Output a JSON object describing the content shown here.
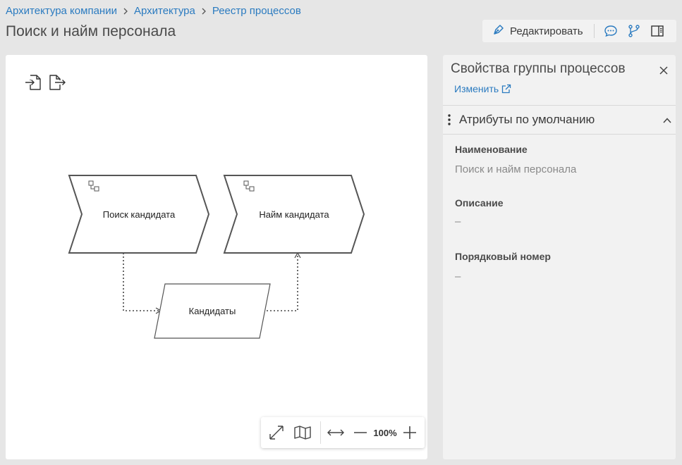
{
  "breadcrumb": {
    "items": [
      "Архитектура компании",
      "Архитектура",
      "Реестр процессов"
    ]
  },
  "page": {
    "title": "Поиск и найм персонала"
  },
  "toolbar": {
    "edit_label": "Редактировать",
    "icons": [
      "pen-icon",
      "comment-icon",
      "branch-icon",
      "panel-toggle-icon"
    ]
  },
  "diagram": {
    "shapes": {
      "process1": "Поиск кандидата",
      "process2": "Найм кандидата",
      "data": "Кандидаты"
    }
  },
  "zoom": {
    "level": "100%"
  },
  "panel": {
    "title": "Свойства группы процессов",
    "edit_link": "Изменить",
    "section_title": "Атрибуты по умолчанию",
    "attributes": [
      {
        "label": "Наименование",
        "value": "Поиск и найм персонала"
      },
      {
        "label": "Описание",
        "value": "–"
      },
      {
        "label": "Порядковый номер",
        "value": "–"
      }
    ]
  },
  "colors": {
    "link": "#2b7bc0",
    "background": "#e6e6e6",
    "panel": "#f2f2f2"
  }
}
